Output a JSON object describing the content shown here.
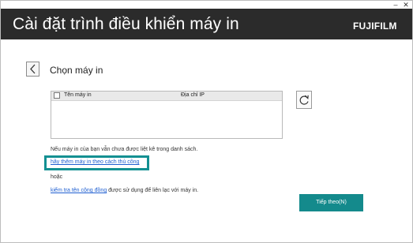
{
  "window": {
    "title": "Cài đặt trình điều khiển máy in",
    "logo_main": "FUJIFILM",
    "logo_accent": "",
    "minimize_glyph": "–",
    "close_glyph": "✕"
  },
  "page": {
    "heading": "Chọn máy in",
    "back_icon": "chevron-left-icon",
    "refresh_icon": "refresh-icon"
  },
  "table": {
    "columns": [
      "Tên máy in",
      "Địa chỉ IP"
    ],
    "rows": []
  },
  "help": {
    "not_found_text": "Nếu máy in của bạn vẫn chưa được liệt kê trong danh sách.",
    "manual_link": "hãy thêm máy in theo cách thủ công",
    "or_text": "hoặc",
    "check_link": "kiểm tra tên cộng đồng",
    "check_suffix": " được sử dụng để liên lạc với máy in."
  },
  "buttons": {
    "next": "Tiếp theo(N)"
  },
  "colors": {
    "header_bg": "#2b2b2b",
    "accent_teal": "#148a8c",
    "link_blue": "#1f5fd1"
  }
}
